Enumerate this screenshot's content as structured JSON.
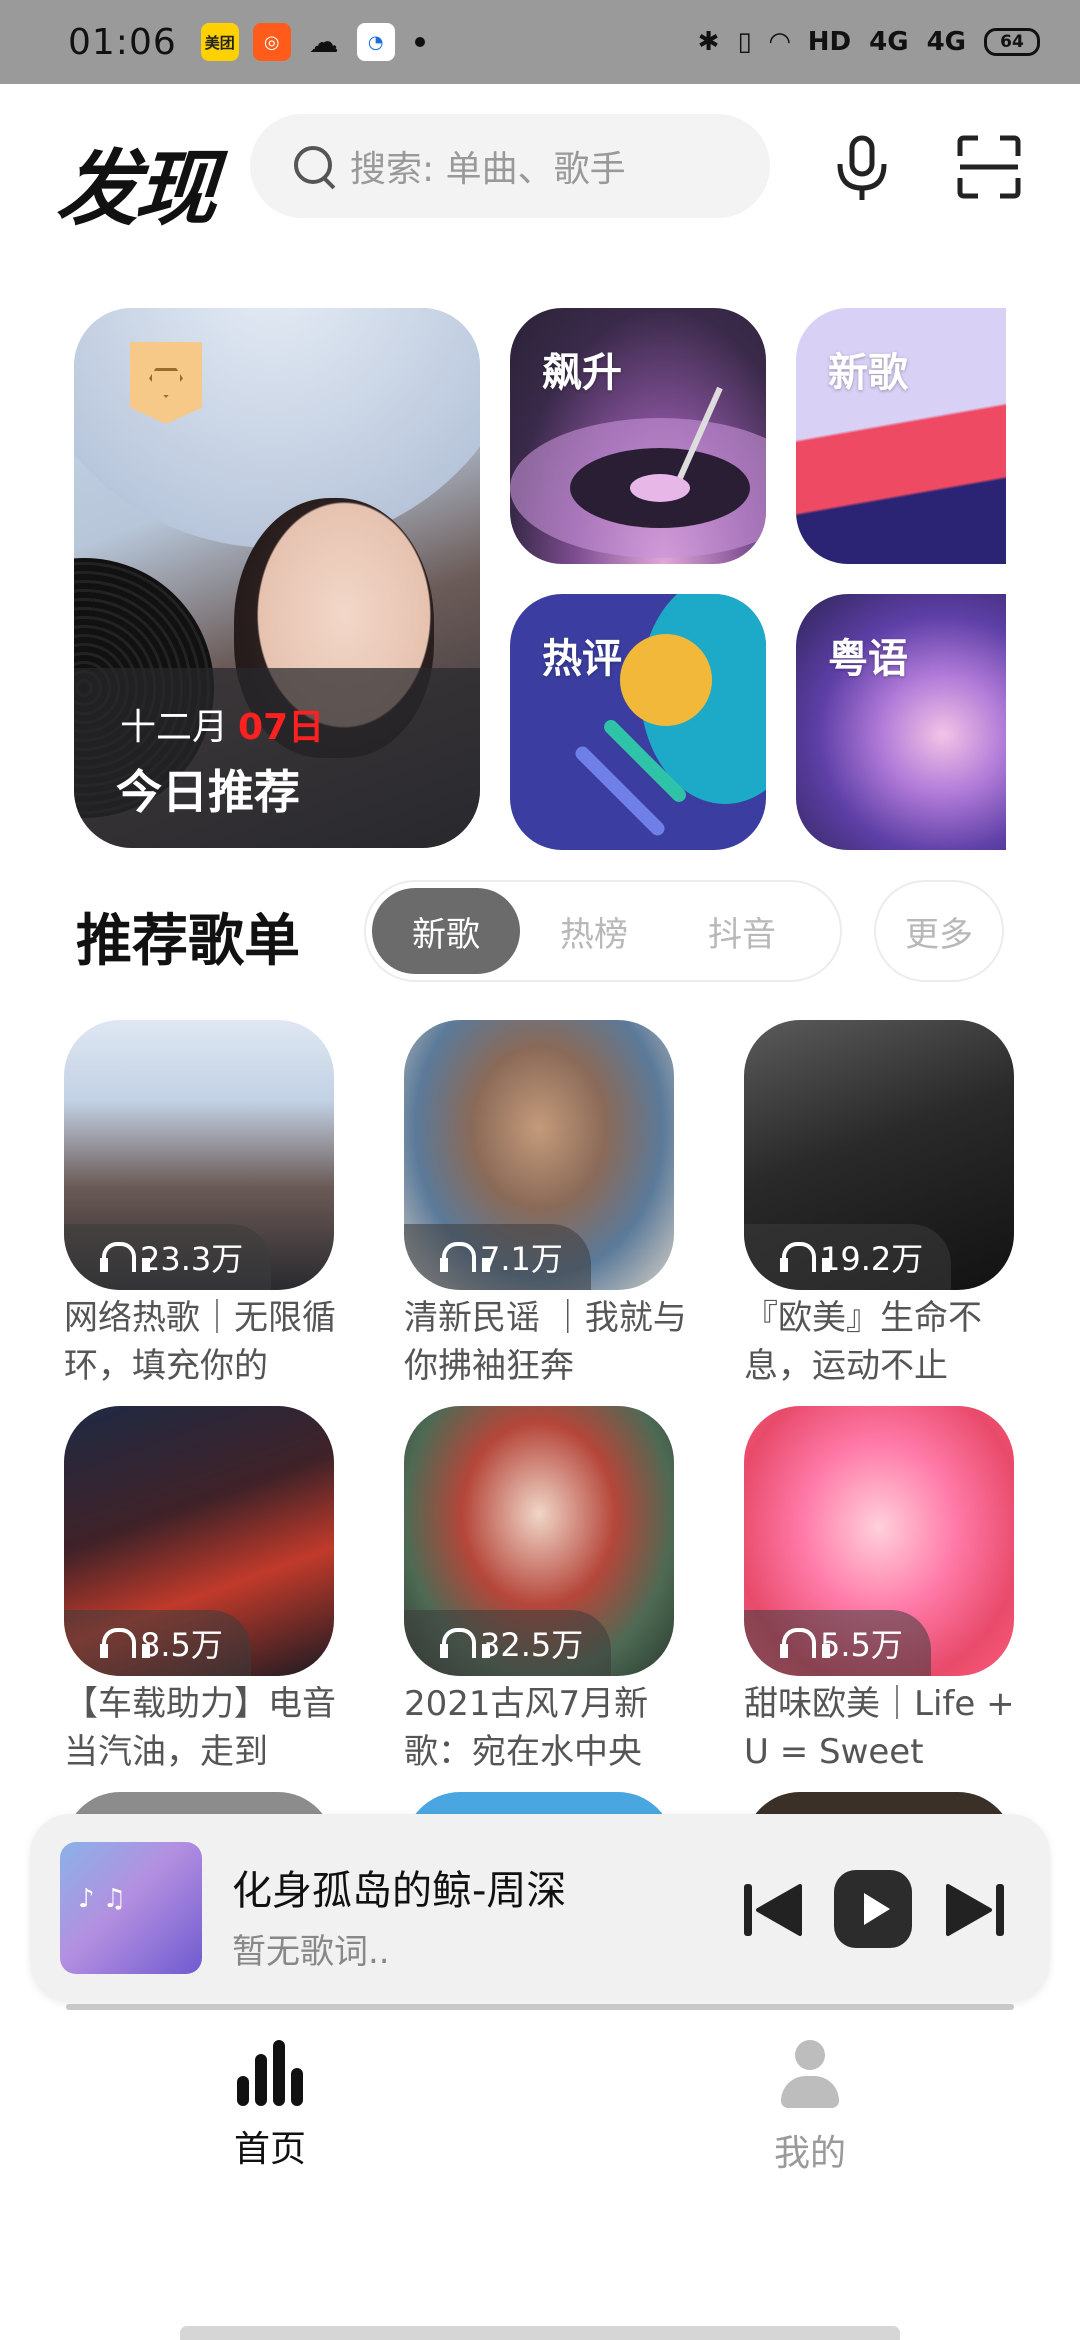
{
  "status_bar": {
    "time": "01:06",
    "apps": [
      "美团",
      "快手",
      "微信",
      "天气"
    ],
    "network": "HD",
    "signal1": "4G",
    "signal2": "4G",
    "battery": "64"
  },
  "header": {
    "title": "发现",
    "search_placeholder": "搜索: 单曲、歌手"
  },
  "featured": {
    "main": {
      "date_prefix": "十二月",
      "date_day": "07日",
      "title": "今日推荐"
    },
    "tiles": [
      {
        "label": "飙升"
      },
      {
        "label": "新歌"
      },
      {
        "label": "热评"
      },
      {
        "label": "粤语"
      }
    ]
  },
  "playlists_section": {
    "title": "推荐歌单",
    "tabs": [
      "新歌",
      "热榜",
      "抖音"
    ],
    "active_tab": "新歌",
    "more_label": "更多",
    "items": [
      {
        "plays": "23.3万",
        "title": "网络热歌｜无限循环，填充你的"
      },
      {
        "plays": "7.1万",
        "title": "清新民谣 ｜我就与你拂袖狂奔"
      },
      {
        "plays": "19.2万",
        "title": "『欧美』生命不息，运动不止"
      },
      {
        "plays": "8.5万",
        "title": "【车载助力】电音当汽油，走到"
      },
      {
        "plays": "32.5万",
        "title": "2021古风7月新歌：宛在水中央"
      },
      {
        "plays": "5.5万",
        "title": "甜味欧美｜Life + U = Sweet"
      }
    ]
  },
  "player": {
    "song": "化身孤岛的鲸-周深",
    "lyrics": "暂无歌词.."
  },
  "bottom_nav": {
    "home_label": "首页",
    "mine_label": "我的"
  }
}
